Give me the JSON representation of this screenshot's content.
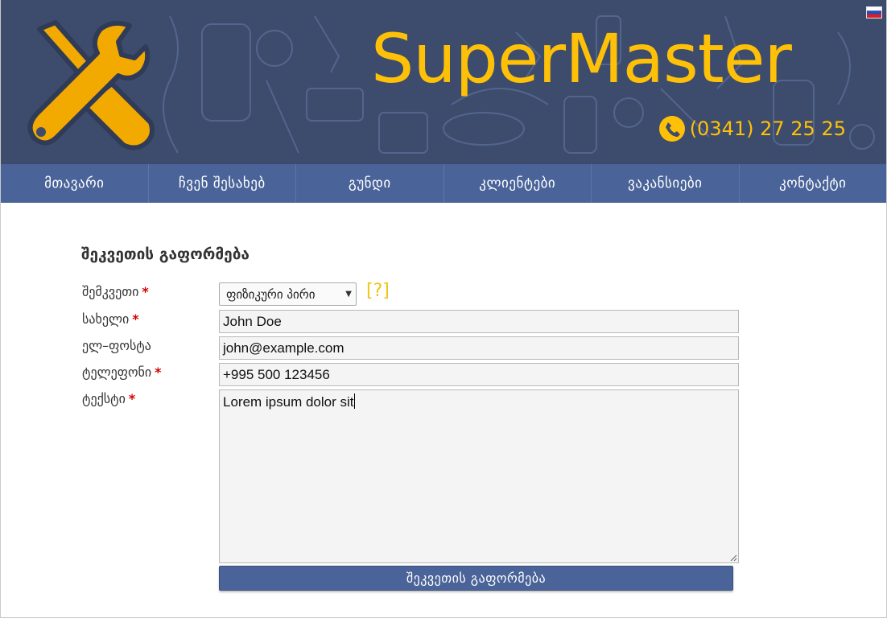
{
  "brand": {
    "name": "SuperMaster",
    "phone": "(0341) 27 25 25",
    "accent_color": "#ffc107",
    "header_bg": "#3d4c6c"
  },
  "language_flag": "ru-flag-icon",
  "nav": {
    "items": [
      {
        "label": "მთავარი"
      },
      {
        "label": "ჩვენ შესახებ"
      },
      {
        "label": "გუნდი"
      },
      {
        "label": "კლიენტები"
      },
      {
        "label": "ვაკანსიები"
      },
      {
        "label": "კონტაქტი"
      }
    ],
    "bg_color": "#4a6499"
  },
  "form": {
    "title": "შეკვეთის გაფორმება",
    "required_mark": "*",
    "customer": {
      "label": "შემკვეთი",
      "selected": "ფიზიკური პირი",
      "help": "[?]"
    },
    "name": {
      "label": "სახელი",
      "value": "John Doe"
    },
    "email": {
      "label": "ელ–ფოსტა",
      "value": "john@example.com"
    },
    "phone": {
      "label": "ტელეფონი",
      "value": "+995 500 123456"
    },
    "text": {
      "label": "ტექსტი",
      "value": "Lorem ipsum dolor sit"
    },
    "submit_label": "შეკვეთის გაფორმება"
  }
}
